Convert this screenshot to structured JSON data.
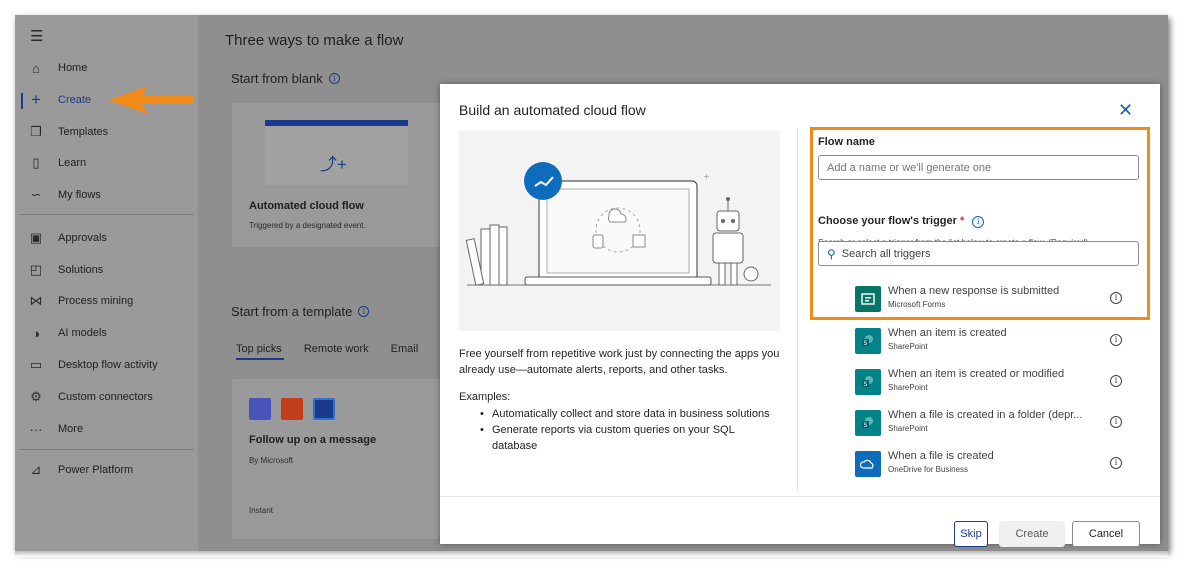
{
  "sidebar": {
    "items": [
      {
        "label": "Home",
        "icon": "home-icon"
      },
      {
        "label": "Create",
        "icon": "plus-icon"
      },
      {
        "label": "Templates",
        "icon": "templates-icon"
      },
      {
        "label": "Learn",
        "icon": "book-icon"
      },
      {
        "label": "My flows",
        "icon": "flow-icon"
      },
      {
        "label": "Approvals",
        "icon": "approvals-icon"
      },
      {
        "label": "Solutions",
        "icon": "solutions-icon"
      },
      {
        "label": "Process mining",
        "icon": "process-mining-icon"
      },
      {
        "label": "AI models",
        "icon": "ai-models-icon"
      },
      {
        "label": "Desktop flow activity",
        "icon": "desktop-flow-icon"
      },
      {
        "label": "Custom connectors",
        "icon": "connector-icon"
      },
      {
        "label": "More",
        "icon": "more-icon"
      },
      {
        "label": "Power Platform",
        "icon": "power-platform-icon"
      }
    ]
  },
  "main": {
    "title": "Three ways to make a flow",
    "blank_section": "Start from blank",
    "blank_card": {
      "title": "Automated cloud flow",
      "subtitle": "Triggered by a designated event."
    },
    "template_section": "Start from a template",
    "tabs": [
      "Top picks",
      "Remote work",
      "Email"
    ],
    "template_card": {
      "title": "Follow up on a message",
      "author": "By Microsoft",
      "type": "Instant"
    }
  },
  "modal": {
    "title": "Build an automated cloud flow",
    "description": "Free yourself from repetitive work just by connecting the apps you already use—automate alerts, reports, and other tasks.",
    "examples_label": "Examples:",
    "examples": [
      "Automatically collect and store data in business solutions",
      "Generate reports via custom queries on your SQL database"
    ],
    "flow_name_label": "Flow name",
    "flow_name_placeholder": "Add a name or we'll generate one",
    "trigger_label": "Choose your flow's trigger",
    "required_mark": "*",
    "trigger_helper": "Search or select a trigger from the list below to create a flow. (Required)",
    "search_placeholder": "Search all triggers",
    "triggers": [
      {
        "name": "When a new response is submitted",
        "source": "Microsoft Forms",
        "color": "#077568"
      },
      {
        "name": "When an item is created",
        "source": "SharePoint",
        "color": "#038387"
      },
      {
        "name": "When an item is created or modified",
        "source": "SharePoint",
        "color": "#038387"
      },
      {
        "name": "When a file is created in a folder (depr...",
        "source": "SharePoint",
        "color": "#038387"
      },
      {
        "name": "When a file is created",
        "source": "OneDrive for Business",
        "color": "#0f6cbd"
      }
    ],
    "buttons": {
      "skip": "Skip",
      "create": "Create",
      "cancel": "Cancel"
    }
  },
  "colors": {
    "accent": "#1a3a8a",
    "annotation": "#f08a18"
  }
}
